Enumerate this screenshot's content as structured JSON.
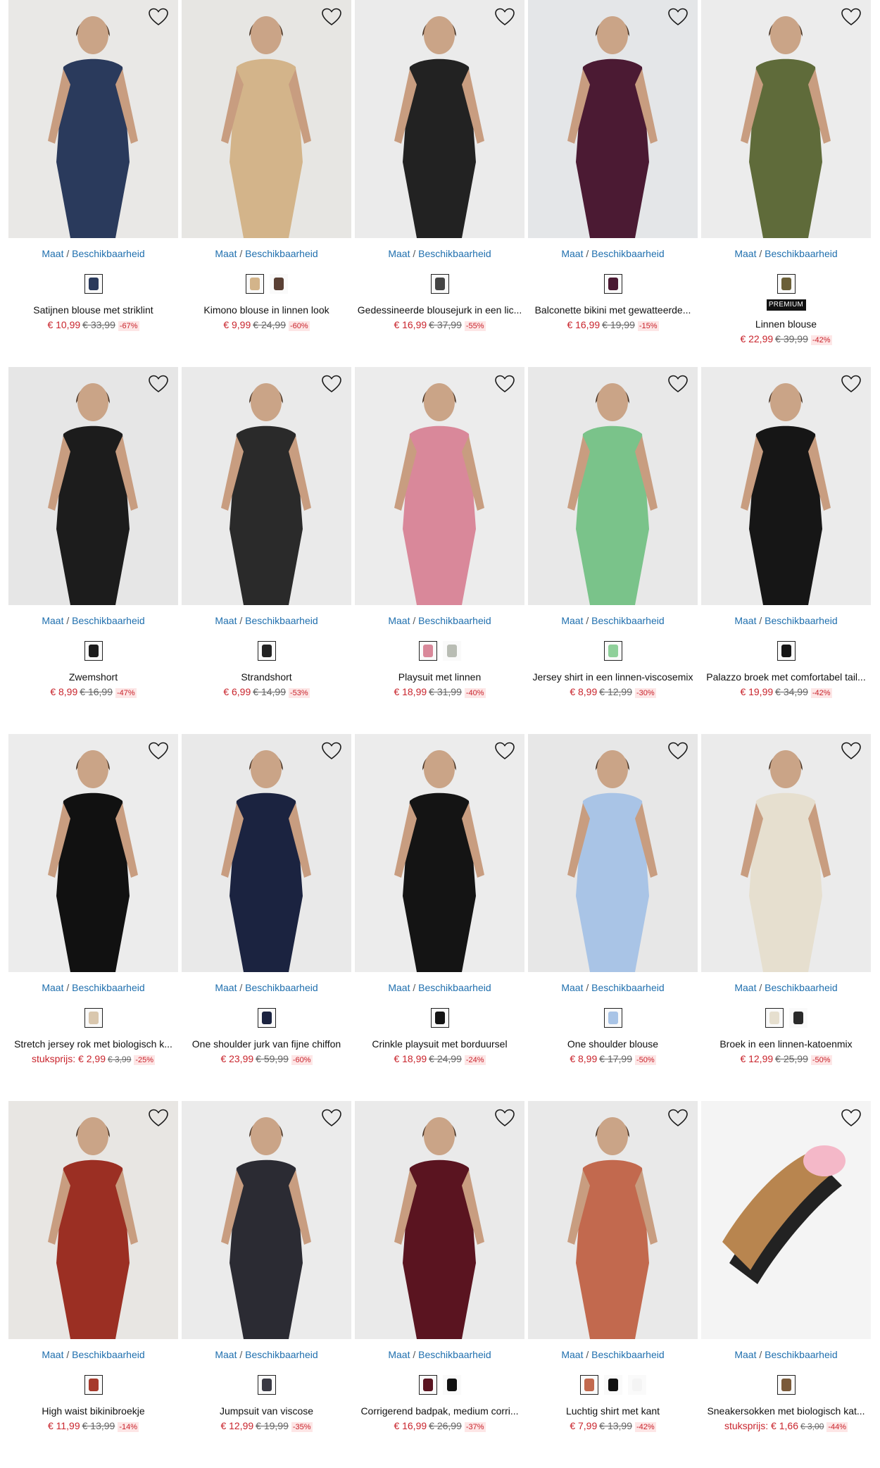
{
  "size_link": {
    "maat": "Maat",
    "separator": "/",
    "beschikbaarheid": "Beschikbaarheid"
  },
  "products": [
    {
      "name": "Satijnen blouse met striklint",
      "price": "€ 10,99",
      "old_price": "€ 33,99",
      "discount": "-67%",
      "bg": "#e9e8e6",
      "fig": "#2a3a5c",
      "swatches": [
        "#2a3a5c"
      ]
    },
    {
      "name": "Kimono blouse in linnen look",
      "price": "€ 9,99",
      "old_price": "€ 24,99",
      "discount": "-60%",
      "bg": "#e7e6e3",
      "fig": "#d3b48a",
      "swatches": [
        "#d3b48a",
        "#5a4034"
      ]
    },
    {
      "name": "Gedessineerde blousejurk in een lic...",
      "price": "€ 16,99",
      "old_price": "€ 37,99",
      "discount": "-55%",
      "bg": "#ebebeb",
      "fig": "#222222",
      "swatches": [
        "#444444"
      ]
    },
    {
      "name": "Balconette bikini met gewatteerde...",
      "price": "€ 16,99",
      "old_price": "€ 19,99",
      "discount": "-15%",
      "bg": "#e4e6e8",
      "fig": "#4b1a33",
      "swatches": [
        "#4b1a33"
      ]
    },
    {
      "name": "Linnen blouse",
      "price": "€ 22,99",
      "old_price": "€ 39,99",
      "discount": "-42%",
      "bg": "#ececec",
      "fig": "#5f6b3a",
      "swatches": [
        "#6b6038"
      ],
      "premium": "PREMIUM"
    },
    {
      "name": "Zwemshort",
      "price": "€ 8,99",
      "old_price": "€ 16,99",
      "discount": "-47%",
      "bg": "#e6e6e6",
      "fig": "#1c1c1c",
      "swatches": [
        "#1c1c1c"
      ]
    },
    {
      "name": "Strandshort",
      "price": "€ 6,99",
      "old_price": "€ 14,99",
      "discount": "-53%",
      "bg": "#eaeaea",
      "fig": "#2a2a2a",
      "swatches": [
        "#222222"
      ]
    },
    {
      "name": "Playsuit met linnen",
      "price": "€ 18,99",
      "old_price": "€ 31,99",
      "discount": "-40%",
      "bg": "#ececec",
      "fig": "#d9889a",
      "swatches": [
        "#d9889a",
        "#b9bdb4"
      ]
    },
    {
      "name": "Jersey shirt in een linnen-viscosemix",
      "price": "€ 8,99",
      "old_price": "€ 12,99",
      "discount": "-30%",
      "bg": "#e8e8e8",
      "fig": "#7ac38a",
      "swatches": [
        "#8fd09a"
      ]
    },
    {
      "name": "Palazzo broek met comfortabel tail...",
      "price": "€ 19,99",
      "old_price": "€ 34,99",
      "discount": "-42%",
      "bg": "#ebebeb",
      "fig": "#161616",
      "swatches": [
        "#161616"
      ]
    },
    {
      "name": "Stretch jersey rok met biologisch k...",
      "price_prefix": "stuksprijs:",
      "price": "€ 2,99",
      "old_price": "€ 3,99",
      "discount": "-25%",
      "bg": "#ececec",
      "fig": "#111111",
      "swatches": [
        "#d9c7ae"
      ],
      "old_small": true
    },
    {
      "name": "One shoulder jurk van fijne chiffon",
      "price": "€ 23,99",
      "old_price": "€ 59,99",
      "discount": "-60%",
      "bg": "#e9e9e9",
      "fig": "#1b2340",
      "swatches": [
        "#1b2340"
      ]
    },
    {
      "name": "Crinkle playsuit met borduursel",
      "price": "€ 18,99",
      "old_price": "€ 24,99",
      "discount": "-24%",
      "bg": "#ececec",
      "fig": "#141414",
      "swatches": [
        "#141414"
      ]
    },
    {
      "name": "One shoulder blouse",
      "price": "€ 8,99",
      "old_price": "€ 17,99",
      "discount": "-50%",
      "bg": "#e7e7e7",
      "fig": "#a9c4e6",
      "swatches": [
        "#a9c4e6"
      ]
    },
    {
      "name": "Broek in een linnen-katoenmix",
      "price": "€ 12,99",
      "old_price": "€ 25,99",
      "discount": "-50%",
      "bg": "#ebebeb",
      "fig": "#e6dfcf",
      "swatches": [
        "#e6dfcf",
        "#2a2a2a"
      ]
    },
    {
      "name": "High waist bikinibroekje",
      "price": "€ 11,99",
      "old_price": "€ 13,99",
      "discount": "-14%",
      "bg": "#e8e6e3",
      "fig": "#9b2f23",
      "swatches": [
        "#a63a2c"
      ]
    },
    {
      "name": "Jumpsuit van viscose",
      "price": "€ 12,99",
      "old_price": "€ 19,99",
      "discount": "-35%",
      "bg": "#ebebeb",
      "fig": "#2b2b33",
      "swatches": [
        "#3a3a44"
      ]
    },
    {
      "name": "Corrigerend badpak, medium corri...",
      "price": "€ 16,99",
      "old_price": "€ 26,99",
      "discount": "-37%",
      "bg": "#eaeaea",
      "fig": "#5a1420",
      "swatches": [
        "#5a1420",
        "#111111"
      ]
    },
    {
      "name": "Luchtig shirt met kant",
      "price": "€ 7,99",
      "old_price": "€ 13,99",
      "discount": "-42%",
      "bg": "#e9e9e9",
      "fig": "#c2694e",
      "swatches": [
        "#c2694e",
        "#111111",
        "#f4f4f4"
      ]
    },
    {
      "name": "Sneakersokken met biologisch kat...",
      "price_prefix": "stuksprijs:",
      "price": "€ 1,66",
      "old_price": "€ 3,00",
      "discount": "-44%",
      "bg": "#f4f4f4",
      "fig": "#b8854f",
      "swatches": [
        "#7a5a3a"
      ],
      "old_small": true,
      "socks": true
    }
  ]
}
